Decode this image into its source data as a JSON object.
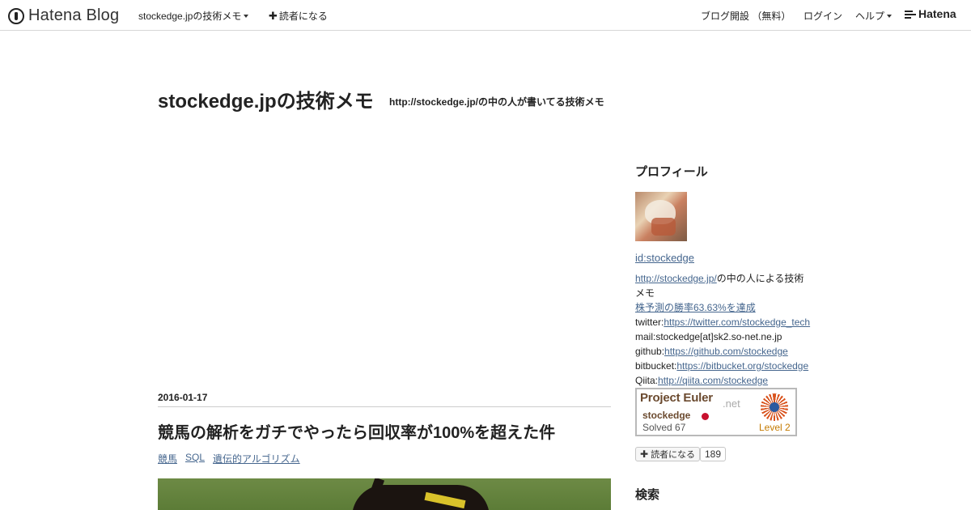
{
  "globalbar": {
    "brand": "Hatena Blog",
    "blog_menu": "stockedge.jpの技術メモ",
    "subscribe": "読者になる",
    "open_blog": "ブログ開設 （無料）",
    "login": "ログイン",
    "help": "ヘルプ",
    "hatena": "Hatena"
  },
  "header": {
    "title": "stockedge.jpの技術メモ",
    "description": "http://stockedge.jp/の中の人が書いてる技術メモ"
  },
  "entry": {
    "date": "2016-01-17",
    "title": "競馬の解析をガチでやったら回収率が100%を超えた件",
    "categories": [
      "競馬",
      "SQL",
      "遺伝的アルゴリズム"
    ]
  },
  "sidebar": {
    "profile_heading": "プロフィール",
    "profile_id": "id:stockedge",
    "lines": {
      "l1_link": "http://stockedge.jp/",
      "l1_text": "の中の人による技術",
      "l2_text": "メモ",
      "l3_link": "株予測の勝率63.63%を達成",
      "l4_label": "twitter:",
      "l4_link": "https://twitter.com/stockedge_tech",
      "l5_text": "mail:stockedge[at]sk2.so-net.ne.jp",
      "l6_label": "github:",
      "l6_link": "https://github.com/stockedge",
      "l7_label": "bitbucket:",
      "l7_link": "https://bitbucket.org/stockedge",
      "l8_label": "Qiita:",
      "l8_link": "http://qiita.com/stockedge"
    },
    "euler": {
      "title": "Project Euler",
      "net": ".net",
      "user": "stockedge",
      "solved": "Solved 67",
      "level": "Level 2"
    },
    "reader_button": "読者になる",
    "reader_count": "189",
    "search_heading": "検索"
  },
  "colors": {
    "link": "#45668e",
    "text": "#222222",
    "euler_brown": "#6b4a2f",
    "euler_level": "#c47a00"
  }
}
